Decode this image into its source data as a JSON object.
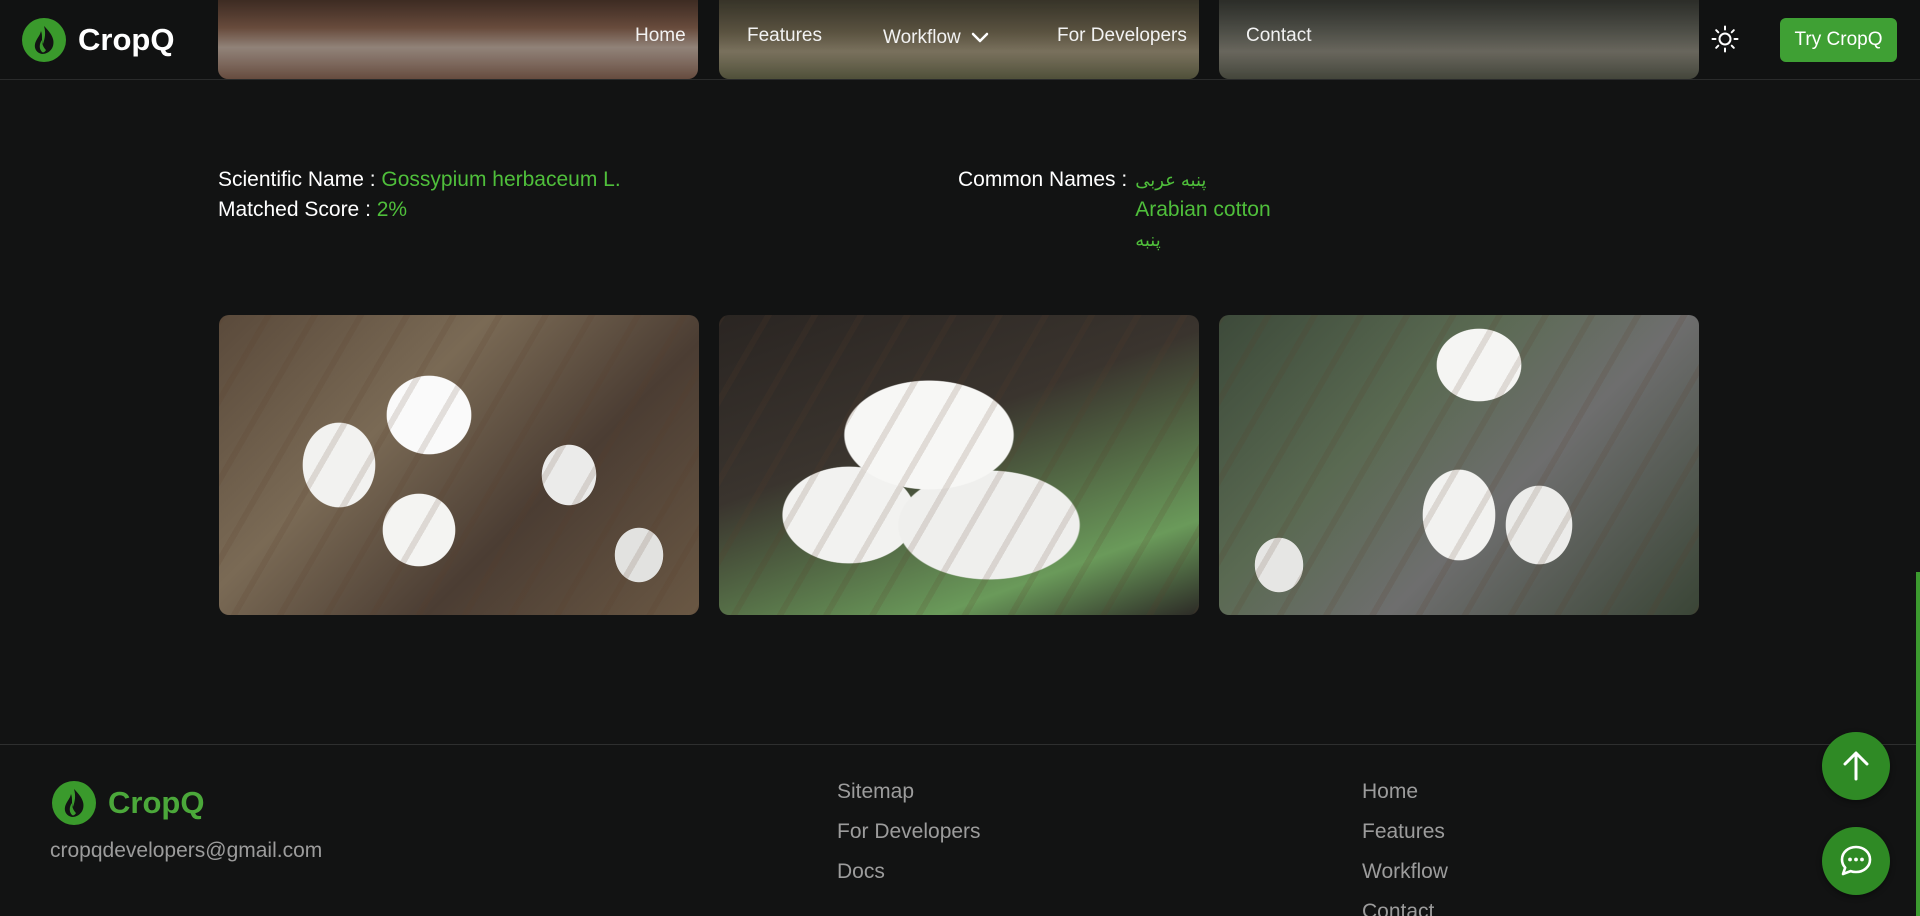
{
  "header": {
    "brand": "CropQ",
    "nav": {
      "home": "Home",
      "features": "Features",
      "workflow": "Workflow",
      "developers": "For Developers",
      "contact": "Contact"
    },
    "try_button": "Try CropQ"
  },
  "result": {
    "scientific_name_label": "Scientific Name :",
    "scientific_name": "Gossypium herbaceum L.",
    "matched_score_label": "Matched Score :",
    "matched_score": "2%",
    "common_names_label": "Common Names :",
    "common_names": [
      "پنبه عربی",
      "Arabian cotton",
      "پنبه"
    ]
  },
  "footer": {
    "brand": "CropQ",
    "email": "cropqdevelopers@gmail.com",
    "col1": [
      "Sitemap",
      "For Developers",
      "Docs"
    ],
    "col2": [
      "Home",
      "Features",
      "Workflow",
      "Contact"
    ]
  },
  "colors": {
    "accent": "#4fbf3b",
    "button": "#3fa034",
    "background": "#121313"
  },
  "icons": {
    "logo": "leaf-flame-icon",
    "theme": "sun-icon",
    "dropdown": "chevron-down-icon",
    "scroll_top": "arrow-up-icon",
    "chat": "chat-bubble-icon"
  }
}
